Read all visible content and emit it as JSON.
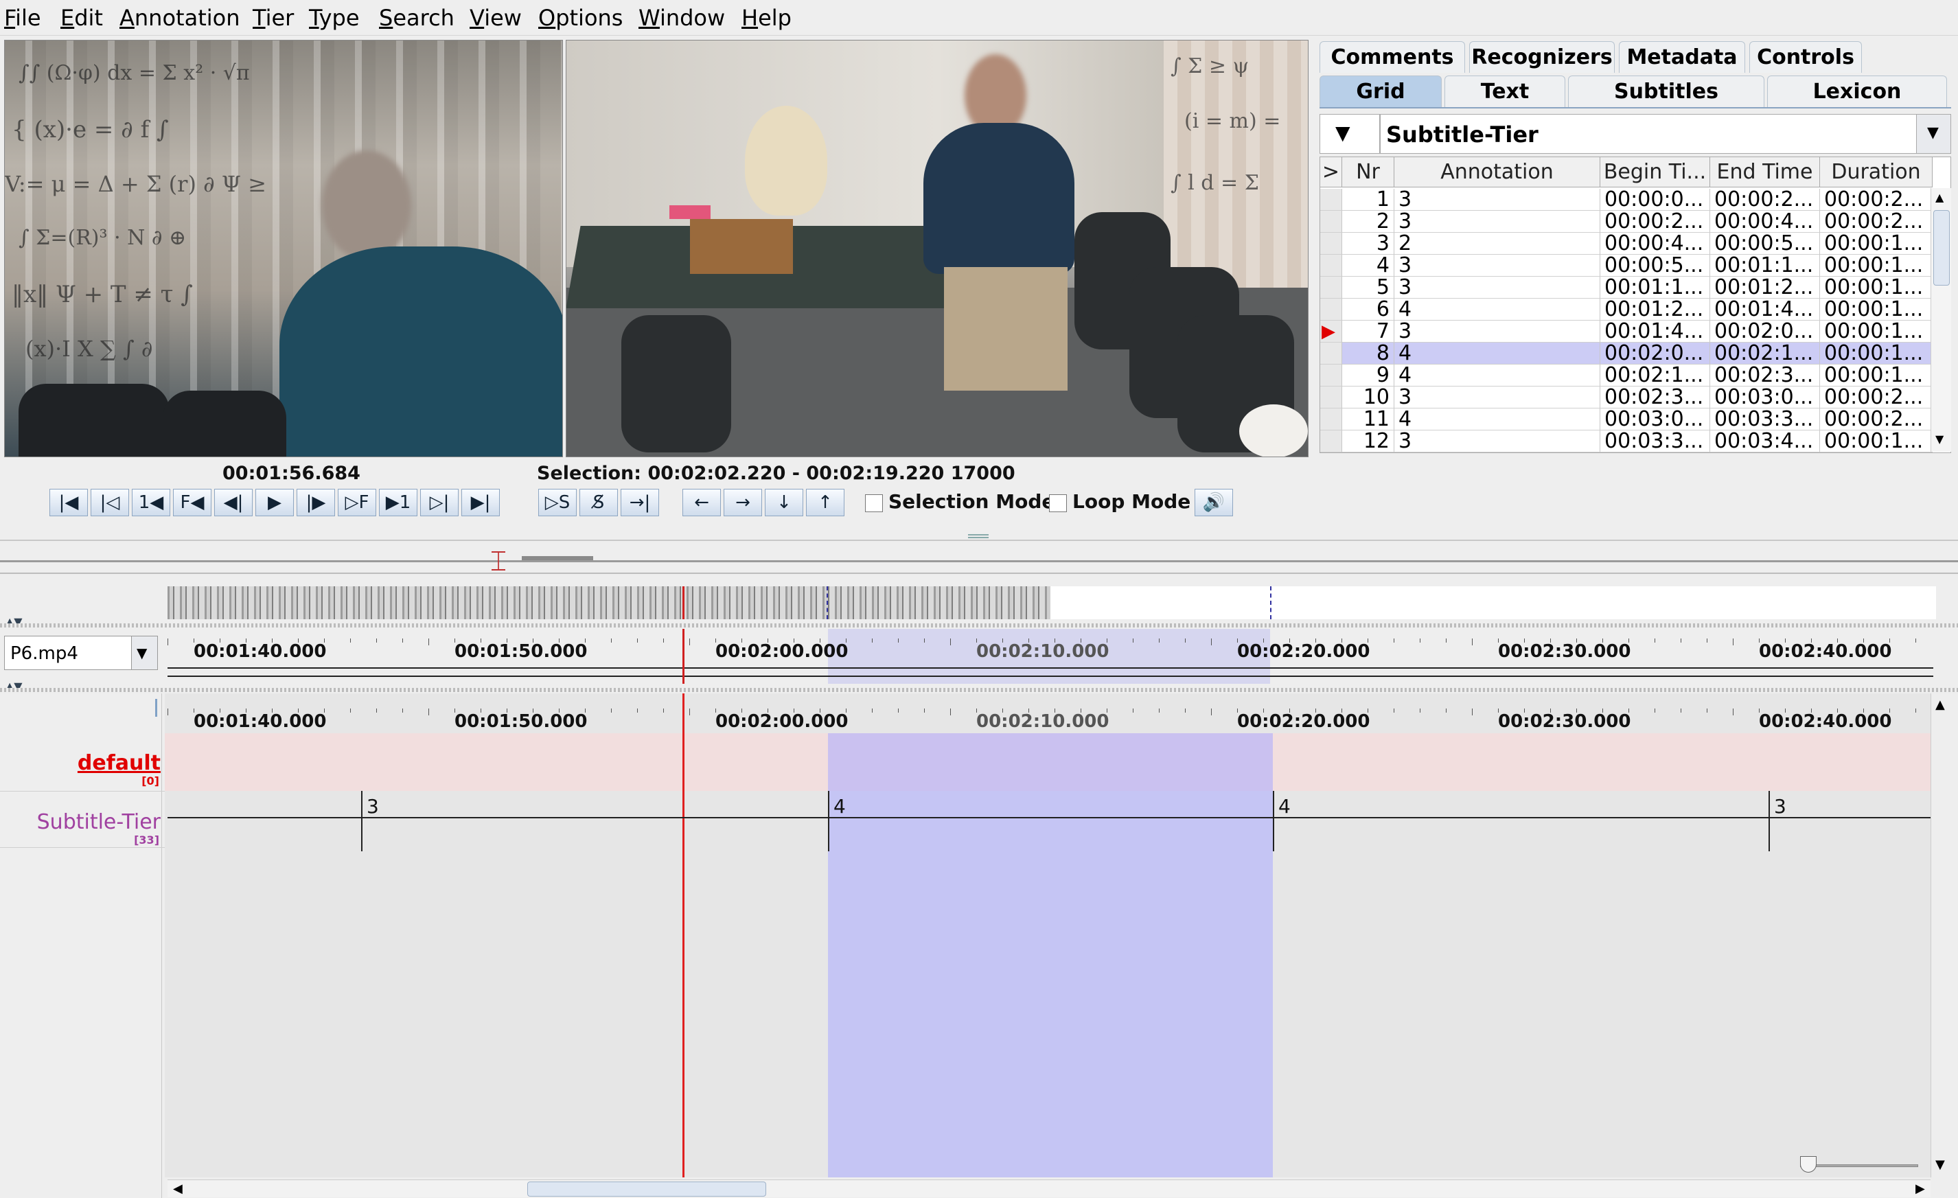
{
  "menu": [
    {
      "label": "File",
      "mn": "F",
      "rest": "ile"
    },
    {
      "label": "Edit",
      "mn": "E",
      "rest": "dit"
    },
    {
      "label": "Annotation",
      "mn": "A",
      "rest": "nnotation"
    },
    {
      "label": "Tier",
      "mn": "T",
      "rest": "ier"
    },
    {
      "label": "Type",
      "mn": "T",
      "rest": "ype"
    },
    {
      "label": "Search",
      "mn": "S",
      "rest": "earch"
    },
    {
      "label": "View",
      "mn": "V",
      "rest": "iew"
    },
    {
      "label": "Options",
      "mn": "O",
      "rest": "ptions"
    },
    {
      "label": "Window",
      "mn": "W",
      "rest": "indow"
    },
    {
      "label": "Help",
      "mn": "H",
      "rest": "elp"
    }
  ],
  "tabs_row1": [
    "Comments",
    "Recognizers",
    "Metadata",
    "Controls"
  ],
  "tabs_row2": [
    "Grid",
    "Text",
    "Subtitles",
    "Lexicon"
  ],
  "active_tab": "Grid",
  "grid": {
    "tier": "Subtitle-Tier",
    "headers": [
      ">",
      "Nr",
      "Annotation",
      "Begin Ti...",
      "End Time",
      "Duration"
    ],
    "rows": [
      {
        "nr": "1",
        "ann": "3",
        "begin": "00:00:0...",
        "end": "00:00:2...",
        "dur": "00:00:2..."
      },
      {
        "nr": "2",
        "ann": "3",
        "begin": "00:00:2...",
        "end": "00:00:4...",
        "dur": "00:00:2..."
      },
      {
        "nr": "3",
        "ann": "2",
        "begin": "00:00:4...",
        "end": "00:00:5...",
        "dur": "00:00:1..."
      },
      {
        "nr": "4",
        "ann": "3",
        "begin": "00:00:5...",
        "end": "00:01:1...",
        "dur": "00:00:1..."
      },
      {
        "nr": "5",
        "ann": "3",
        "begin": "00:01:1...",
        "end": "00:01:2...",
        "dur": "00:00:1..."
      },
      {
        "nr": "6",
        "ann": "4",
        "begin": "00:01:2...",
        "end": "00:01:4...",
        "dur": "00:00:1..."
      },
      {
        "nr": "7",
        "ann": "3",
        "begin": "00:01:4...",
        "end": "00:02:0...",
        "dur": "00:00:1...",
        "current": true
      },
      {
        "nr": "8",
        "ann": "4",
        "begin": "00:02:0...",
        "end": "00:02:1...",
        "dur": "00:00:1...",
        "selected": true
      },
      {
        "nr": "9",
        "ann": "4",
        "begin": "00:02:1...",
        "end": "00:02:3...",
        "dur": "00:00:1..."
      },
      {
        "nr": "10",
        "ann": "3",
        "begin": "00:02:3...",
        "end": "00:03:0...",
        "dur": "00:00:2..."
      },
      {
        "nr": "11",
        "ann": "4",
        "begin": "00:03:0...",
        "end": "00:03:3...",
        "dur": "00:00:2..."
      },
      {
        "nr": "12",
        "ann": "3",
        "begin": "00:03:3...",
        "end": "00:03:4...",
        "dur": "00:00:1..."
      }
    ]
  },
  "player": {
    "current_time": "00:01:56.684",
    "selection": "Selection: 00:02:02.220 - 00:02:19.220  17000",
    "selection_mode": "Selection Mode",
    "loop_mode": "Loop Mode",
    "buttons": [
      "|◀",
      "|◁",
      "1◀",
      "F◀",
      "◀|",
      "▶",
      "|▶",
      "▷F",
      "▶1",
      "▷|",
      "▶|"
    ],
    "sel_buttons": [
      "▷S",
      "S̸",
      "→|"
    ],
    "nav_buttons": [
      "←",
      "→",
      "↓",
      "↑"
    ]
  },
  "timeline": {
    "media_file": "P6.mp4",
    "ticks": [
      "00:01:40.000",
      "00:01:50.000",
      "00:02:00.000",
      "00:02:10.000",
      "00:02:20.000",
      "00:02:30.000",
      "00:02:40.000"
    ],
    "tiers": [
      {
        "name": "default",
        "count": "[0]",
        "color": "#e00000"
      },
      {
        "name": "Subtitle-Tier",
        "count": "[33]",
        "color": "#a040a0"
      }
    ],
    "annotations": [
      "3",
      "4",
      "4",
      "3"
    ]
  }
}
